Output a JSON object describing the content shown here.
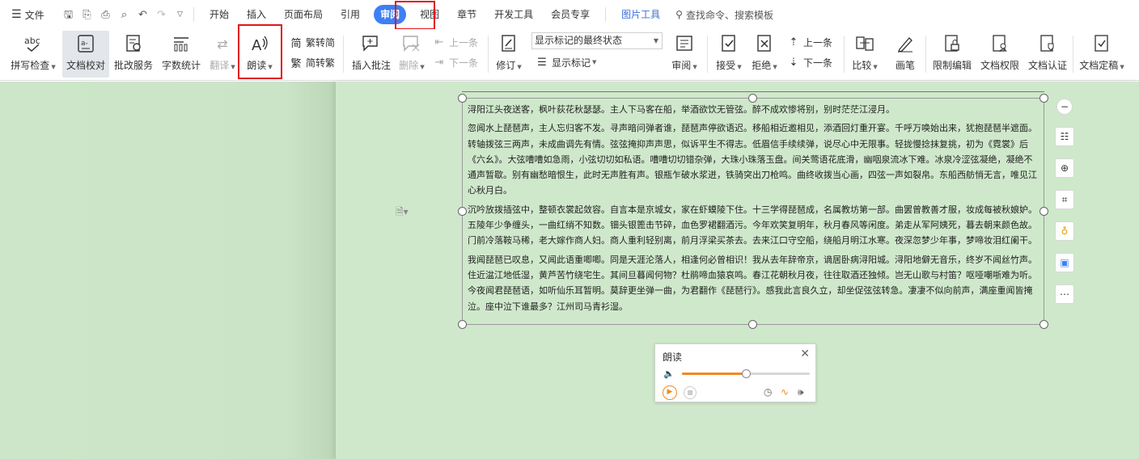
{
  "menu": {
    "file_label": "文件",
    "tabs": [
      "开始",
      "插入",
      "页面布局",
      "引用",
      "审阅",
      "视图",
      "章节",
      "开发工具",
      "会员专享"
    ],
    "active_tab": "审阅",
    "picture_tools": "图片工具",
    "search_placeholder": "查找命令、搜索模板"
  },
  "ribbon": {
    "spellcheck": "拼写检查",
    "doc_proof": "文档校对",
    "correction": "批改服务",
    "word_count": "字数统计",
    "translate": "翻译",
    "read_aloud": "朗读",
    "trad_to_simp": "繁转简",
    "simp_to_trad": "简转繁",
    "insert_comment": "插入批注",
    "delete": "删除",
    "prev_comment": "上一条",
    "next_comment": "下一条",
    "track_changes": "修订",
    "display_mode": "显示标记的最终状态",
    "show_markup": "显示标记",
    "review": "审阅",
    "accept": "接受",
    "reject": "拒绝",
    "prev_change": "上一条",
    "next_change": "下一条",
    "compare": "比较",
    "pen": "画笔",
    "restrict_edit": "限制编辑",
    "doc_permission": "文档权限",
    "doc_auth": "文档认证",
    "doc_finalize": "文档定稿"
  },
  "document": {
    "paragraphs": [
      "浔阳江头夜送客，枫叶荻花秋瑟瑟。主人下马客在船，举酒欲饮无管弦。醉不成欢惨将别，别时茫茫江浸月。",
      "忽闻水上琵琶声，主人忘归客不发。寻声暗问弹者谁，琵琶声停欲语迟。移船相近邀相见，添酒回灯重开宴。千呼万唤始出来，犹抱琵琶半遮面。转轴拨弦三两声，未成曲调先有情。弦弦掩抑声声思，似诉平生不得志。低眉信手续续弹，说尽心中无限事。轻拢慢捻抹复挑，初为《霓裳》后《六幺》。大弦嘈嘈如急雨，小弦切切如私语。嘈嘈切切错杂弹，大珠小珠落玉盘。间关莺语花底滑，幽咽泉流冰下难。冰泉冷涩弦凝绝，凝绝不通声暂歇。别有幽愁暗恨生，此时无声胜有声。银瓶乍破水浆迸，铁骑突出刀枪鸣。曲终收拨当心画，四弦一声如裂帛。东船西舫悄无言，唯见江心秋月白。",
      "沉吟放拨插弦中，整顿衣裳起敛容。自言本是京城女，家在虾蟆陵下住。十三学得琵琶成，名属教坊第一部。曲罢曾教善才服，妆成每被秋娘妒。五陵年少争缠头，一曲红绡不知数。钿头银篦击节碎，血色罗裙翻酒污。今年欢笑复明年，秋月春风等闲度。弟走从军阿姨死，暮去朝来颜色故。门前冷落鞍马稀，老大嫁作商人妇。商人重利轻别离，前月浮梁买茶去。去来江口守空船，绕船月明江水寒。夜深忽梦少年事，梦啼妆泪红阑干。",
      "我闻琵琶已叹息，又闻此语重唧唧。同是天涯沦落人，相逢何必曾相识！我从去年辞帝京，谪居卧病浔阳城。浔阳地僻无音乐，终岁不闻丝竹声。住近湓江地低湿，黄芦苦竹绕宅生。其间旦暮闻何物？杜鹃啼血猿哀鸣。春江花朝秋月夜，往往取酒还独倾。岂无山歌与村笛？呕哑嘲哳难为听。今夜闻君琵琶语，如听仙乐耳暂明。莫辞更坐弹一曲，为君翻作《琵琶行》。感我此言良久立，却坐促弦弦转急。凄凄不似向前声，满座重闻皆掩泣。座中泣下谁最多？江州司马青衫湿。"
    ]
  },
  "reader_panel": {
    "title": "朗读",
    "volume_level": 0.5
  },
  "colors": {
    "accent": "#3d7ff5",
    "highlight_box": "#e1151b",
    "workspace_bg": "#cce5c8",
    "progress": "#f08a24"
  }
}
